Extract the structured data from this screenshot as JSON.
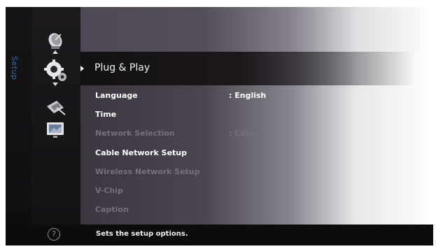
{
  "rail": {
    "label": "Setup"
  },
  "icons": [
    "satellite-dish-icon",
    "gears-icon",
    "network-satellite-icon",
    "tv-screen-icon"
  ],
  "menu": {
    "selected": "Plug & Play",
    "items": [
      {
        "label": "Language",
        "value": ": English",
        "enabled": true
      },
      {
        "label": "Time",
        "value": "",
        "enabled": true
      },
      {
        "label": "Network Selection",
        "value": ": Cable",
        "enabled": false
      },
      {
        "label": "Cable Network Setup",
        "value": "",
        "enabled": true
      },
      {
        "label": "Wireless Network Setup",
        "value": "",
        "enabled": false
      },
      {
        "label": "V-Chip",
        "value": "",
        "enabled": false
      },
      {
        "label": "Caption",
        "value": "",
        "enabled": false
      }
    ]
  },
  "status": {
    "help_glyph": "?",
    "text": "Sets the setup options."
  },
  "colors": {
    "rail_label": "#2f6fa8",
    "enabled_text": "#ffffff",
    "disabled_text": "#75707a"
  }
}
